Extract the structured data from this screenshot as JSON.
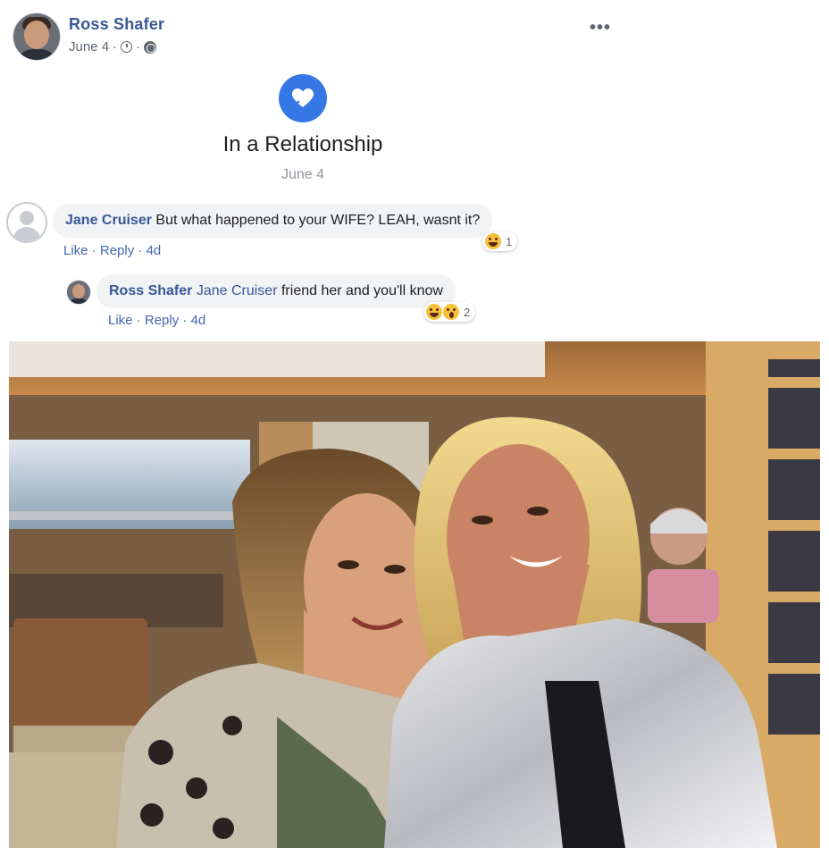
{
  "post": {
    "author": "Ross Shafer",
    "date": "June 4",
    "separator1": "·",
    "separator2": "·",
    "more_menu": "•••",
    "icons": [
      "clock-icon",
      "globe-icon"
    ]
  },
  "life_event": {
    "icon": "heart-icon",
    "title": "In a Relationship",
    "date": "June 4",
    "accent": "#3578e5"
  },
  "comments": [
    {
      "author": "Jane Cruiser",
      "text": "But what happened to your WIFE? LEAH, wasnt it?",
      "actions": {
        "like": "Like",
        "sep1": "·",
        "reply": "Reply",
        "sep2": "·",
        "time": "4d"
      },
      "reactions": {
        "icons": [
          "laugh-emoji"
        ],
        "count": "1"
      }
    },
    {
      "author": "Ross Shafer",
      "mention": "Jane Cruiser",
      "text": "friend her and you'll know",
      "actions": {
        "like": "Like",
        "sep1": "·",
        "reply": "Reply",
        "sep2": "·",
        "time": "4d"
      },
      "reactions": {
        "icons": [
          "laugh-emoji",
          "wow-emoji"
        ],
        "count": "2"
      }
    }
  ],
  "colors": {
    "link_blue": "#385898",
    "meta_gray": "#606770",
    "bubble_bg": "#f2f3f5"
  }
}
